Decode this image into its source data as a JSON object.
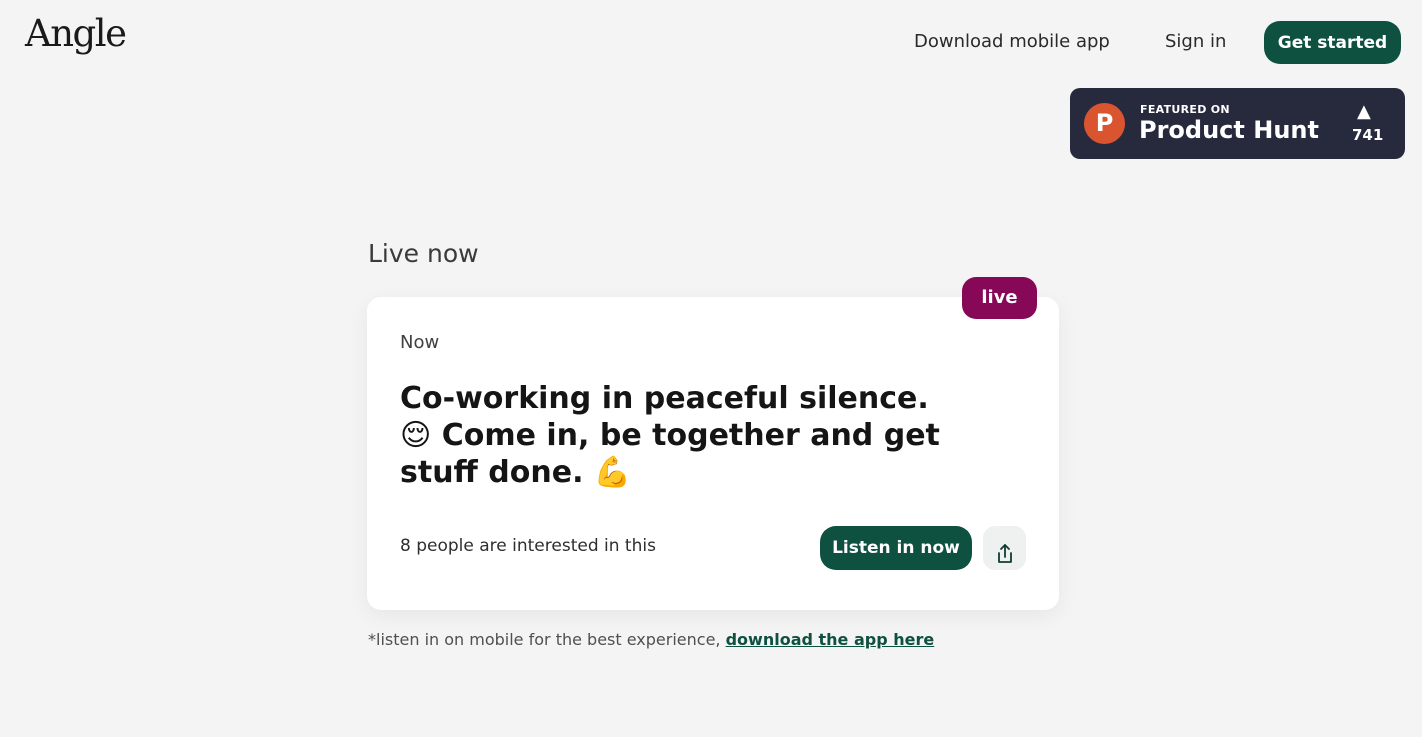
{
  "header": {
    "logo": "Angle",
    "nav": {
      "download": "Download mobile app",
      "signin": "Sign in"
    },
    "cta": "Get started"
  },
  "product_hunt": {
    "featured": "FEATURED ON",
    "name": "Product Hunt",
    "logo_letter": "P",
    "upvote_icon": "▲",
    "count": "741"
  },
  "section": {
    "title": "Live now"
  },
  "card": {
    "badge": "live",
    "time": "Now",
    "title": "Co-working in peaceful silence. 😌 Come in, be together and get stuff done. 💪",
    "interest": "8 people are interested in this",
    "listen_button": "Listen in now",
    "share_icon": "share-icon"
  },
  "footnote": {
    "text": "*listen in on mobile for the best experience, ",
    "link": "download the app here"
  },
  "colors": {
    "background": "#f4f4f4",
    "primary": "#0f5141",
    "live_badge": "#870856",
    "product_hunt_bg": "#262a3c",
    "product_hunt_logo": "#da552f"
  }
}
